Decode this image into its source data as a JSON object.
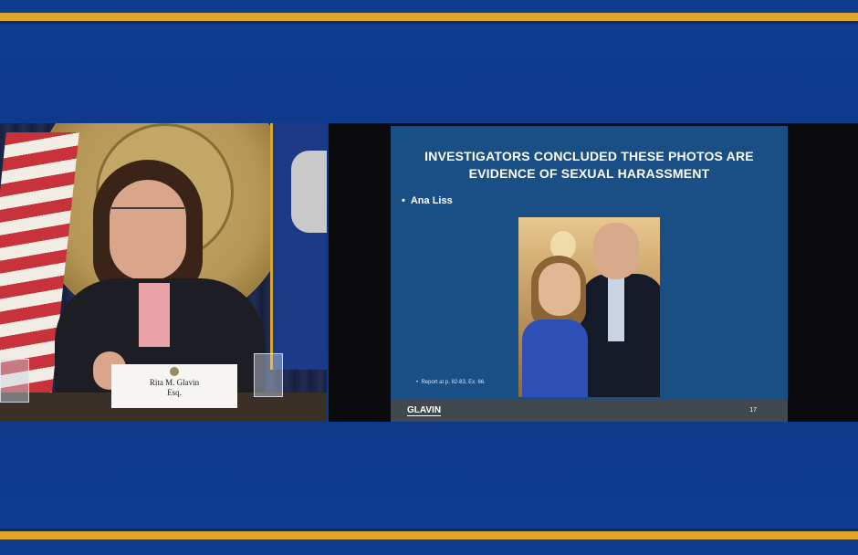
{
  "slide": {
    "title_line1": "INVESTIGATORS CONCLUDED THESE PHOTOS ARE",
    "title_line2": "EVIDENCE OF SEXUAL HARASSMENT",
    "bullet": "Ana Liss",
    "footnote": "Report at p. 82-83, Ex. 66.",
    "footer_logo": "GLAVIN",
    "page_number": "17"
  },
  "nameplate": {
    "name": "Rita M. Glavin",
    "title": "Esq."
  },
  "colors": {
    "frame_blue": "#0f3d90",
    "gold_stripe": "#e0a62a",
    "slide_blue": "#1a4f86"
  }
}
